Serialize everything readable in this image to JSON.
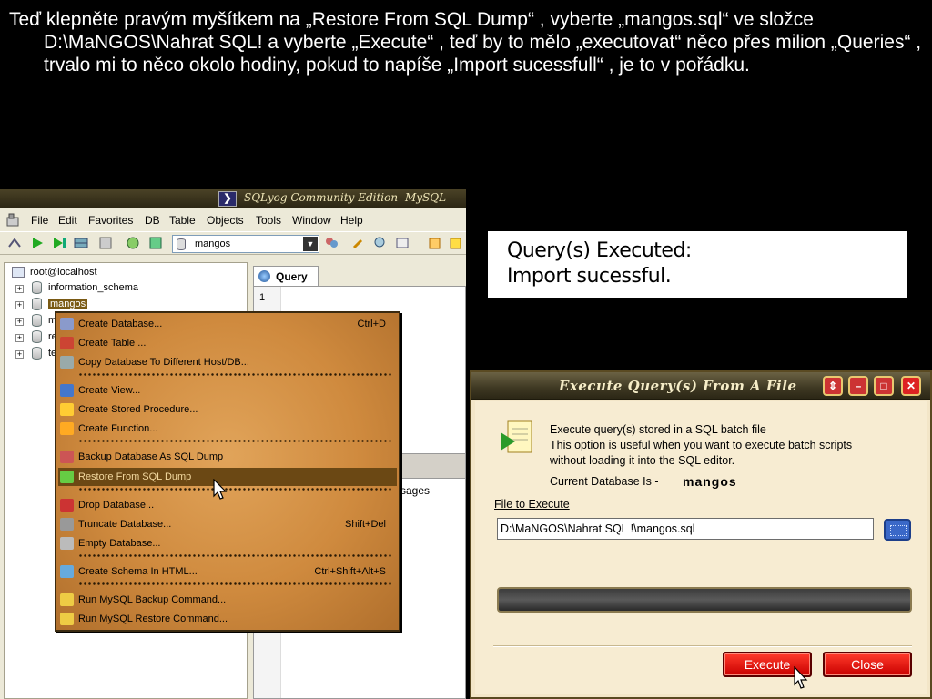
{
  "slide": {
    "instruction": "Teď klepněte pravým myšítkem na „Restore From SQL Dump“ , vyberte „mangos.sql“ ve složce D:\\MaNGOS\\Nahrat SQL!  a vyberte „Execute“ , teď by to mělo „executovat“ něco přes milion „Queries“ , trvalo mi to něco okolo hodiny, pokud to napíše „Import sucessfull“ , je to v pořádku."
  },
  "sqlyog": {
    "title": "SQLyog Community Edition- MySQL -",
    "menu": [
      "File",
      "Edit",
      "Favorites",
      "DB",
      "Table",
      "Objects",
      "Tools",
      "Window",
      "Help"
    ],
    "database_select": "mangos",
    "tree": {
      "host": "root@localhost",
      "databases": [
        "information_schema",
        "mangos",
        "m",
        "re",
        "te"
      ]
    },
    "query_tab": "Query",
    "editor_line": "1",
    "messages_tab": "ssages"
  },
  "context_menu": {
    "items": [
      {
        "label": "Create Database...",
        "shortcut": "Ctrl+D"
      },
      {
        "label": "Create Table ...",
        "shortcut": ""
      },
      {
        "label": "Copy Database To Different Host/DB...",
        "shortcut": ""
      },
      {
        "label": "Create View...",
        "shortcut": ""
      },
      {
        "label": "Create Stored Procedure...",
        "shortcut": ""
      },
      {
        "label": "Create Function...",
        "shortcut": ""
      },
      {
        "label": "Backup Database As SQL Dump",
        "shortcut": ""
      },
      {
        "label": "Restore From SQL Dump",
        "shortcut": ""
      },
      {
        "label": "Drop Database...",
        "shortcut": ""
      },
      {
        "label": "Truncate Database...",
        "shortcut": "Shift+Del"
      },
      {
        "label": "Empty Database...",
        "shortcut": ""
      },
      {
        "label": "Create Schema In HTML...",
        "shortcut": "Ctrl+Shift+Alt+S"
      },
      {
        "label": "Run MySQL Backup Command...",
        "shortcut": ""
      },
      {
        "label": "Run MySQL Restore Command...",
        "shortcut": ""
      }
    ],
    "highlighted": "Restore From SQL Dump"
  },
  "executed_box": {
    "line1": "Query(s) Executed:",
    "line2": "Import sucessful."
  },
  "dialog": {
    "title": "Execute Query(s) From A File",
    "desc1": "Execute query(s) stored in a SQL batch file",
    "desc2": "This option is useful when you want to execute batch scripts",
    "desc3": "without loading it into the SQL editor.",
    "current_db_label": "Current Database Is -",
    "current_db": "mangos",
    "file_label": "File to Execute",
    "file_path": "D:\\MaNGOS\\Nahrat SQL !\\mangos.sql",
    "execute_label": "Execute",
    "close_label": "Close"
  },
  "colors": {
    "menu_bg": "#d08b3f",
    "highlight": "#6b4814",
    "button_red": "#d80000"
  }
}
